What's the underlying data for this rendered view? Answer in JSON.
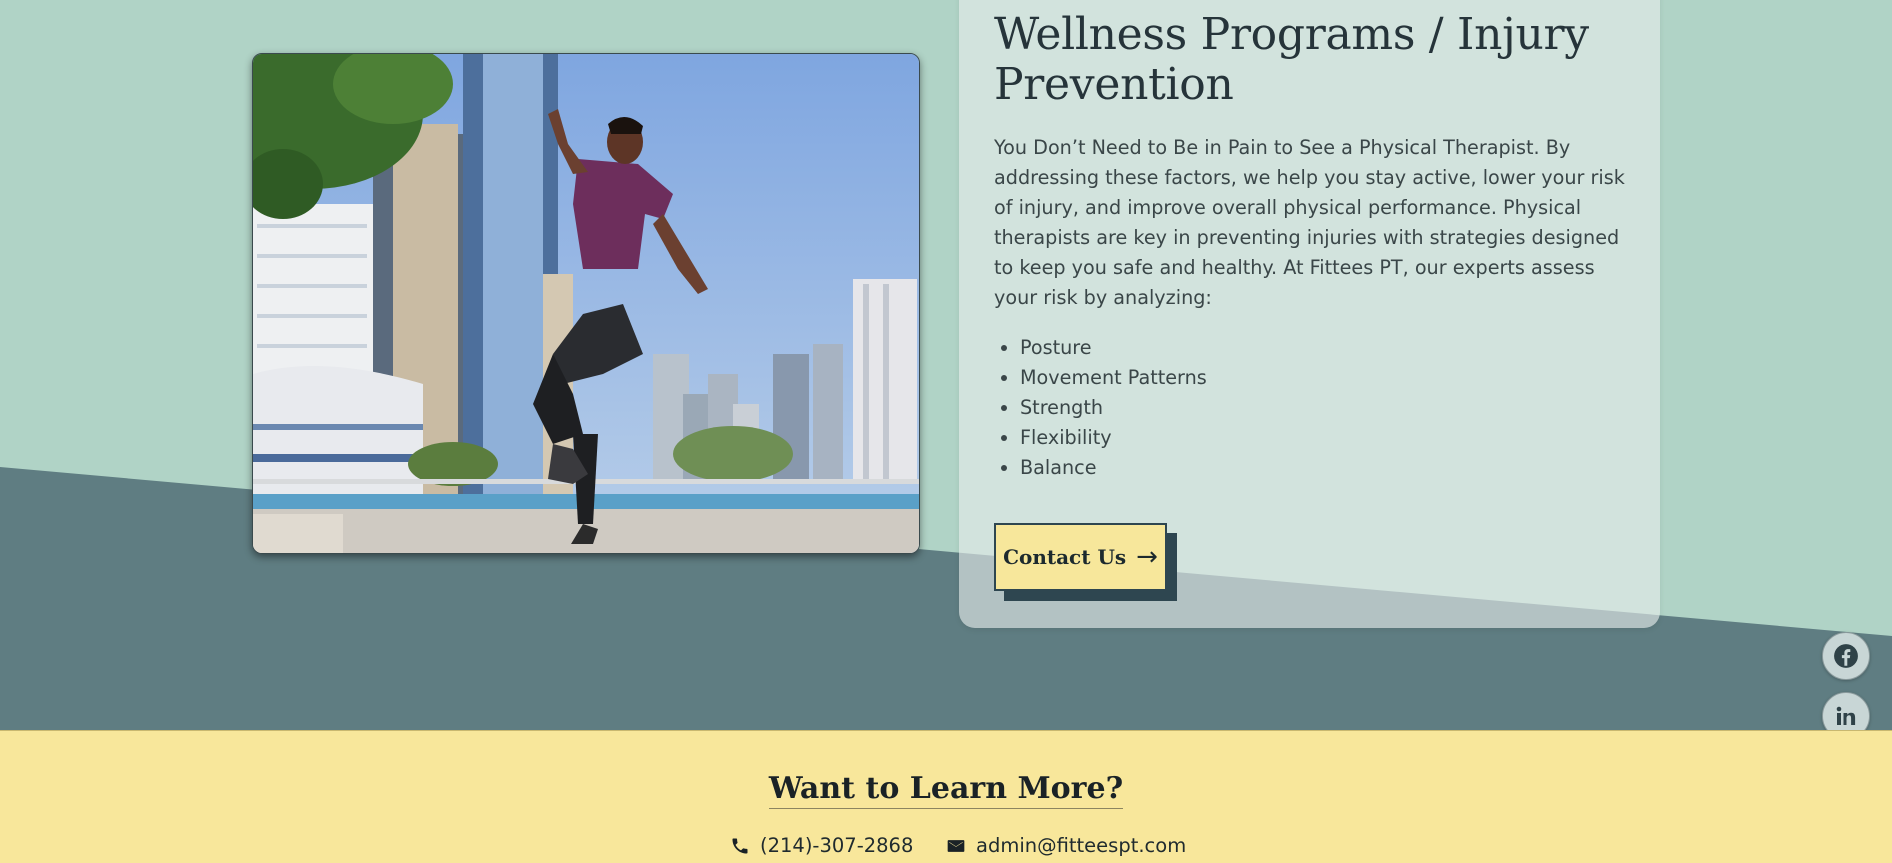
{
  "program": {
    "title": "Wellness Programs / Injury Prevention",
    "description": "You Don’t Need to Be in Pain to See a Physical Therapist. By addressing these factors, we help you stay active, lower your risk of injury, and improve overall physical performance. Physical therapists are key in preventing injuries with strategies designed to keep you safe and healthy. At Fittees PT, our experts assess your risk by analyzing:",
    "factors": [
      "Posture",
      "Movement Patterns",
      "Strength",
      "Flexibility",
      "Balance"
    ],
    "contact_label": "Contact Us",
    "contact_icon": "arrow-right-icon"
  },
  "social": [
    {
      "name": "facebook-icon"
    },
    {
      "name": "linkedin-icon"
    },
    {
      "name": "instagram-icon"
    }
  ],
  "footer": {
    "title": "Want to Learn More?",
    "phone": "(214)-307-2868",
    "email": "admin@fitteespt.com"
  },
  "colors": {
    "background_light": "#b0d3c6",
    "background_dark": "#5f7d82",
    "footer": "#f8e79b",
    "button": "#f7e79b",
    "button_shadow": "#2e4650"
  }
}
